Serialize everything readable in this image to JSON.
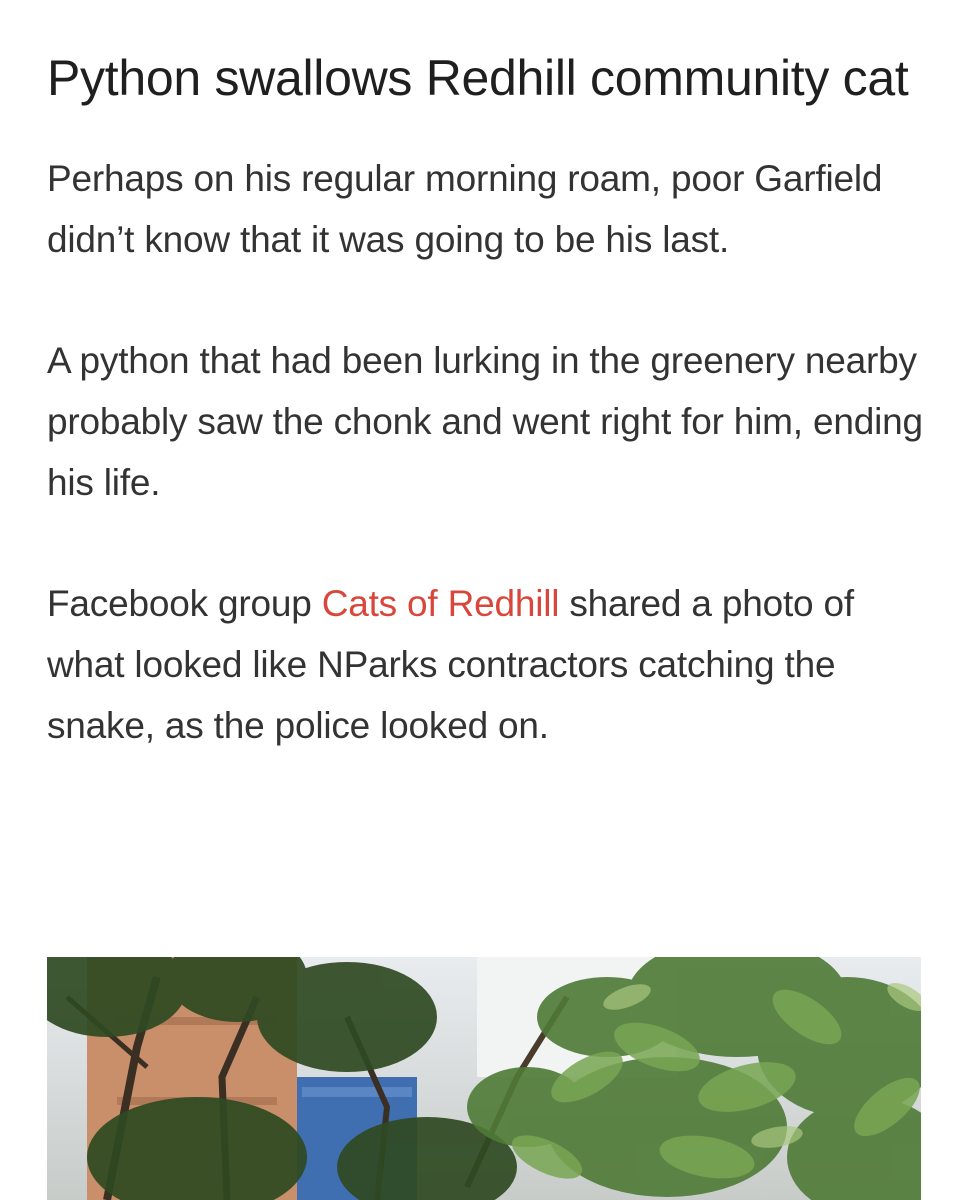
{
  "article": {
    "headline": "Python swallows Redhill community cat",
    "paragraphs": [
      "Perhaps on his regular morning roam, poor Garfield didn’t know that it was going to be his last.",
      "A python that had been lurking in the greenery nearby probably saw the chonk and went right for him, ending his life."
    ],
    "paragraph3": {
      "before_link": "Facebook group ",
      "link_text": "Cats of Redhill",
      "after_link": " shared a photo of what looked like NParks contractors catching the snake, as the police looked on."
    },
    "link_color": "#d9473c"
  },
  "photo": {
    "icon": "photo-trees-image"
  }
}
